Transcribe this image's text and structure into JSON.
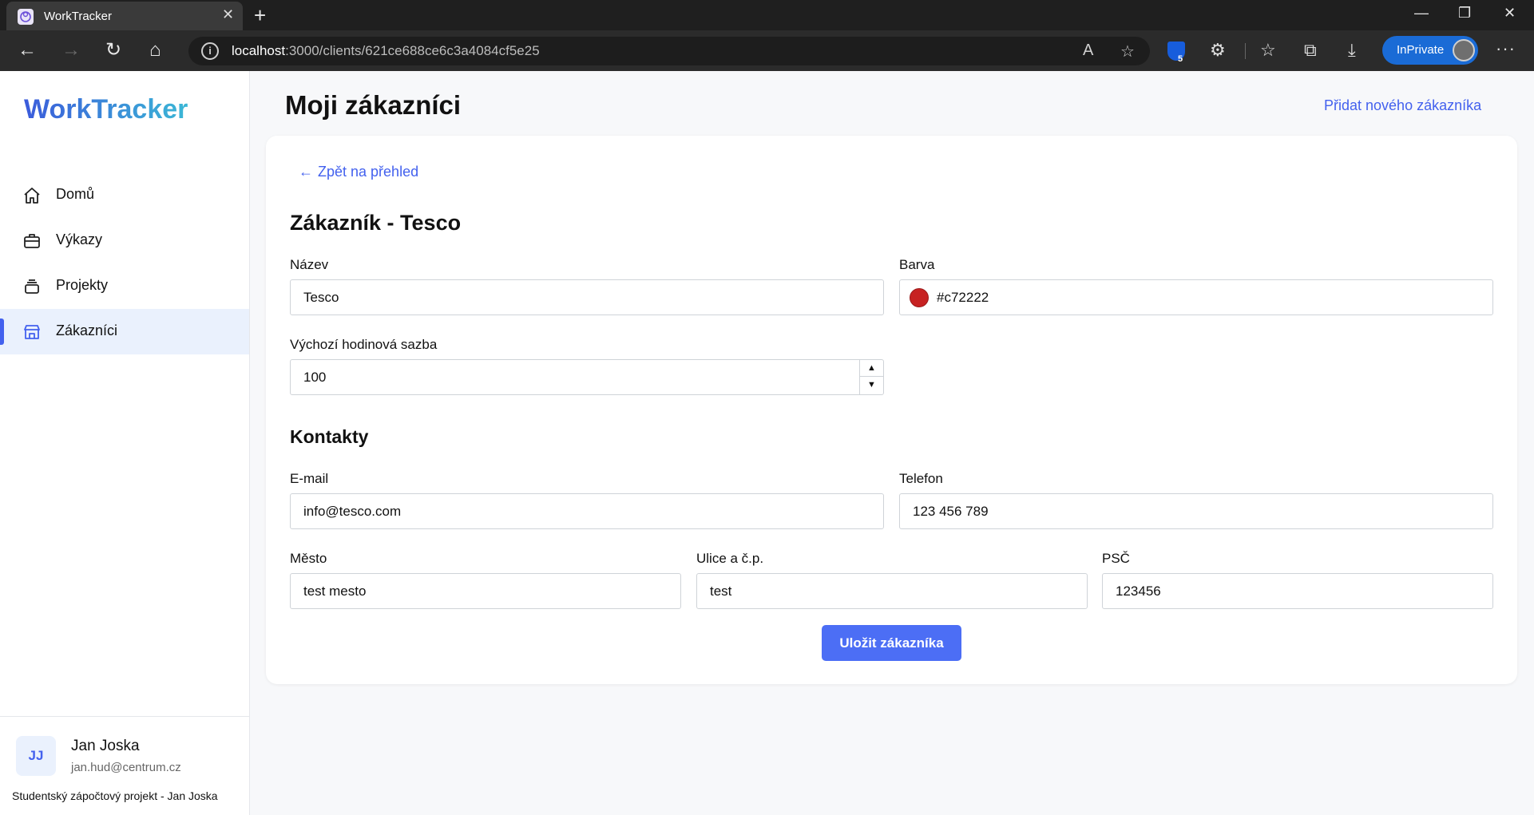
{
  "browser": {
    "tab_title": "WorkTracker",
    "url_host": "localhost",
    "url_path": ":3000/clients/621ce688ce6c3a4084cf5e25",
    "inprivate_label": "InPrivate",
    "extension_badge": "5"
  },
  "sidebar": {
    "brand": "WorkTracker",
    "items": [
      {
        "label": "Domů",
        "icon": "home-icon",
        "active": false
      },
      {
        "label": "Výkazy",
        "icon": "briefcase-icon",
        "active": false
      },
      {
        "label": "Projekty",
        "icon": "stack-icon",
        "active": false
      },
      {
        "label": "Zákazníci",
        "icon": "store-icon",
        "active": true
      }
    ],
    "user": {
      "initials": "JJ",
      "name": "Jan Joska",
      "email": "jan.hud@centrum.cz"
    },
    "footer": "Studentský zápočtový projekt - Jan Joska"
  },
  "header": {
    "title": "Moji zákazníci",
    "add_link": "Přidat nového zákazníka"
  },
  "form": {
    "back_link": "Zpět na přehled",
    "title": "Zákazník - Tesco",
    "name_label": "Název",
    "name_value": "Tesco",
    "color_label": "Barva",
    "color_value": "#c72222",
    "rate_label": "Výchozí hodinová sazba",
    "rate_value": "100",
    "contacts_title": "Kontakty",
    "email_label": "E-mail",
    "email_value": "info@tesco.com",
    "phone_label": "Telefon",
    "phone_value": "123 456 789",
    "city_label": "Město",
    "city_value": "test mesto",
    "street_label": "Ulice a č.p.",
    "street_value": "test",
    "zip_label": "PSČ",
    "zip_value": "123456",
    "save_label": "Uložit zákazníka"
  },
  "colors": {
    "accent": "#4361ee",
    "button": "#4c6ef5",
    "active_nav_bg": "#eaf1fd",
    "client_color": "#c72222"
  }
}
